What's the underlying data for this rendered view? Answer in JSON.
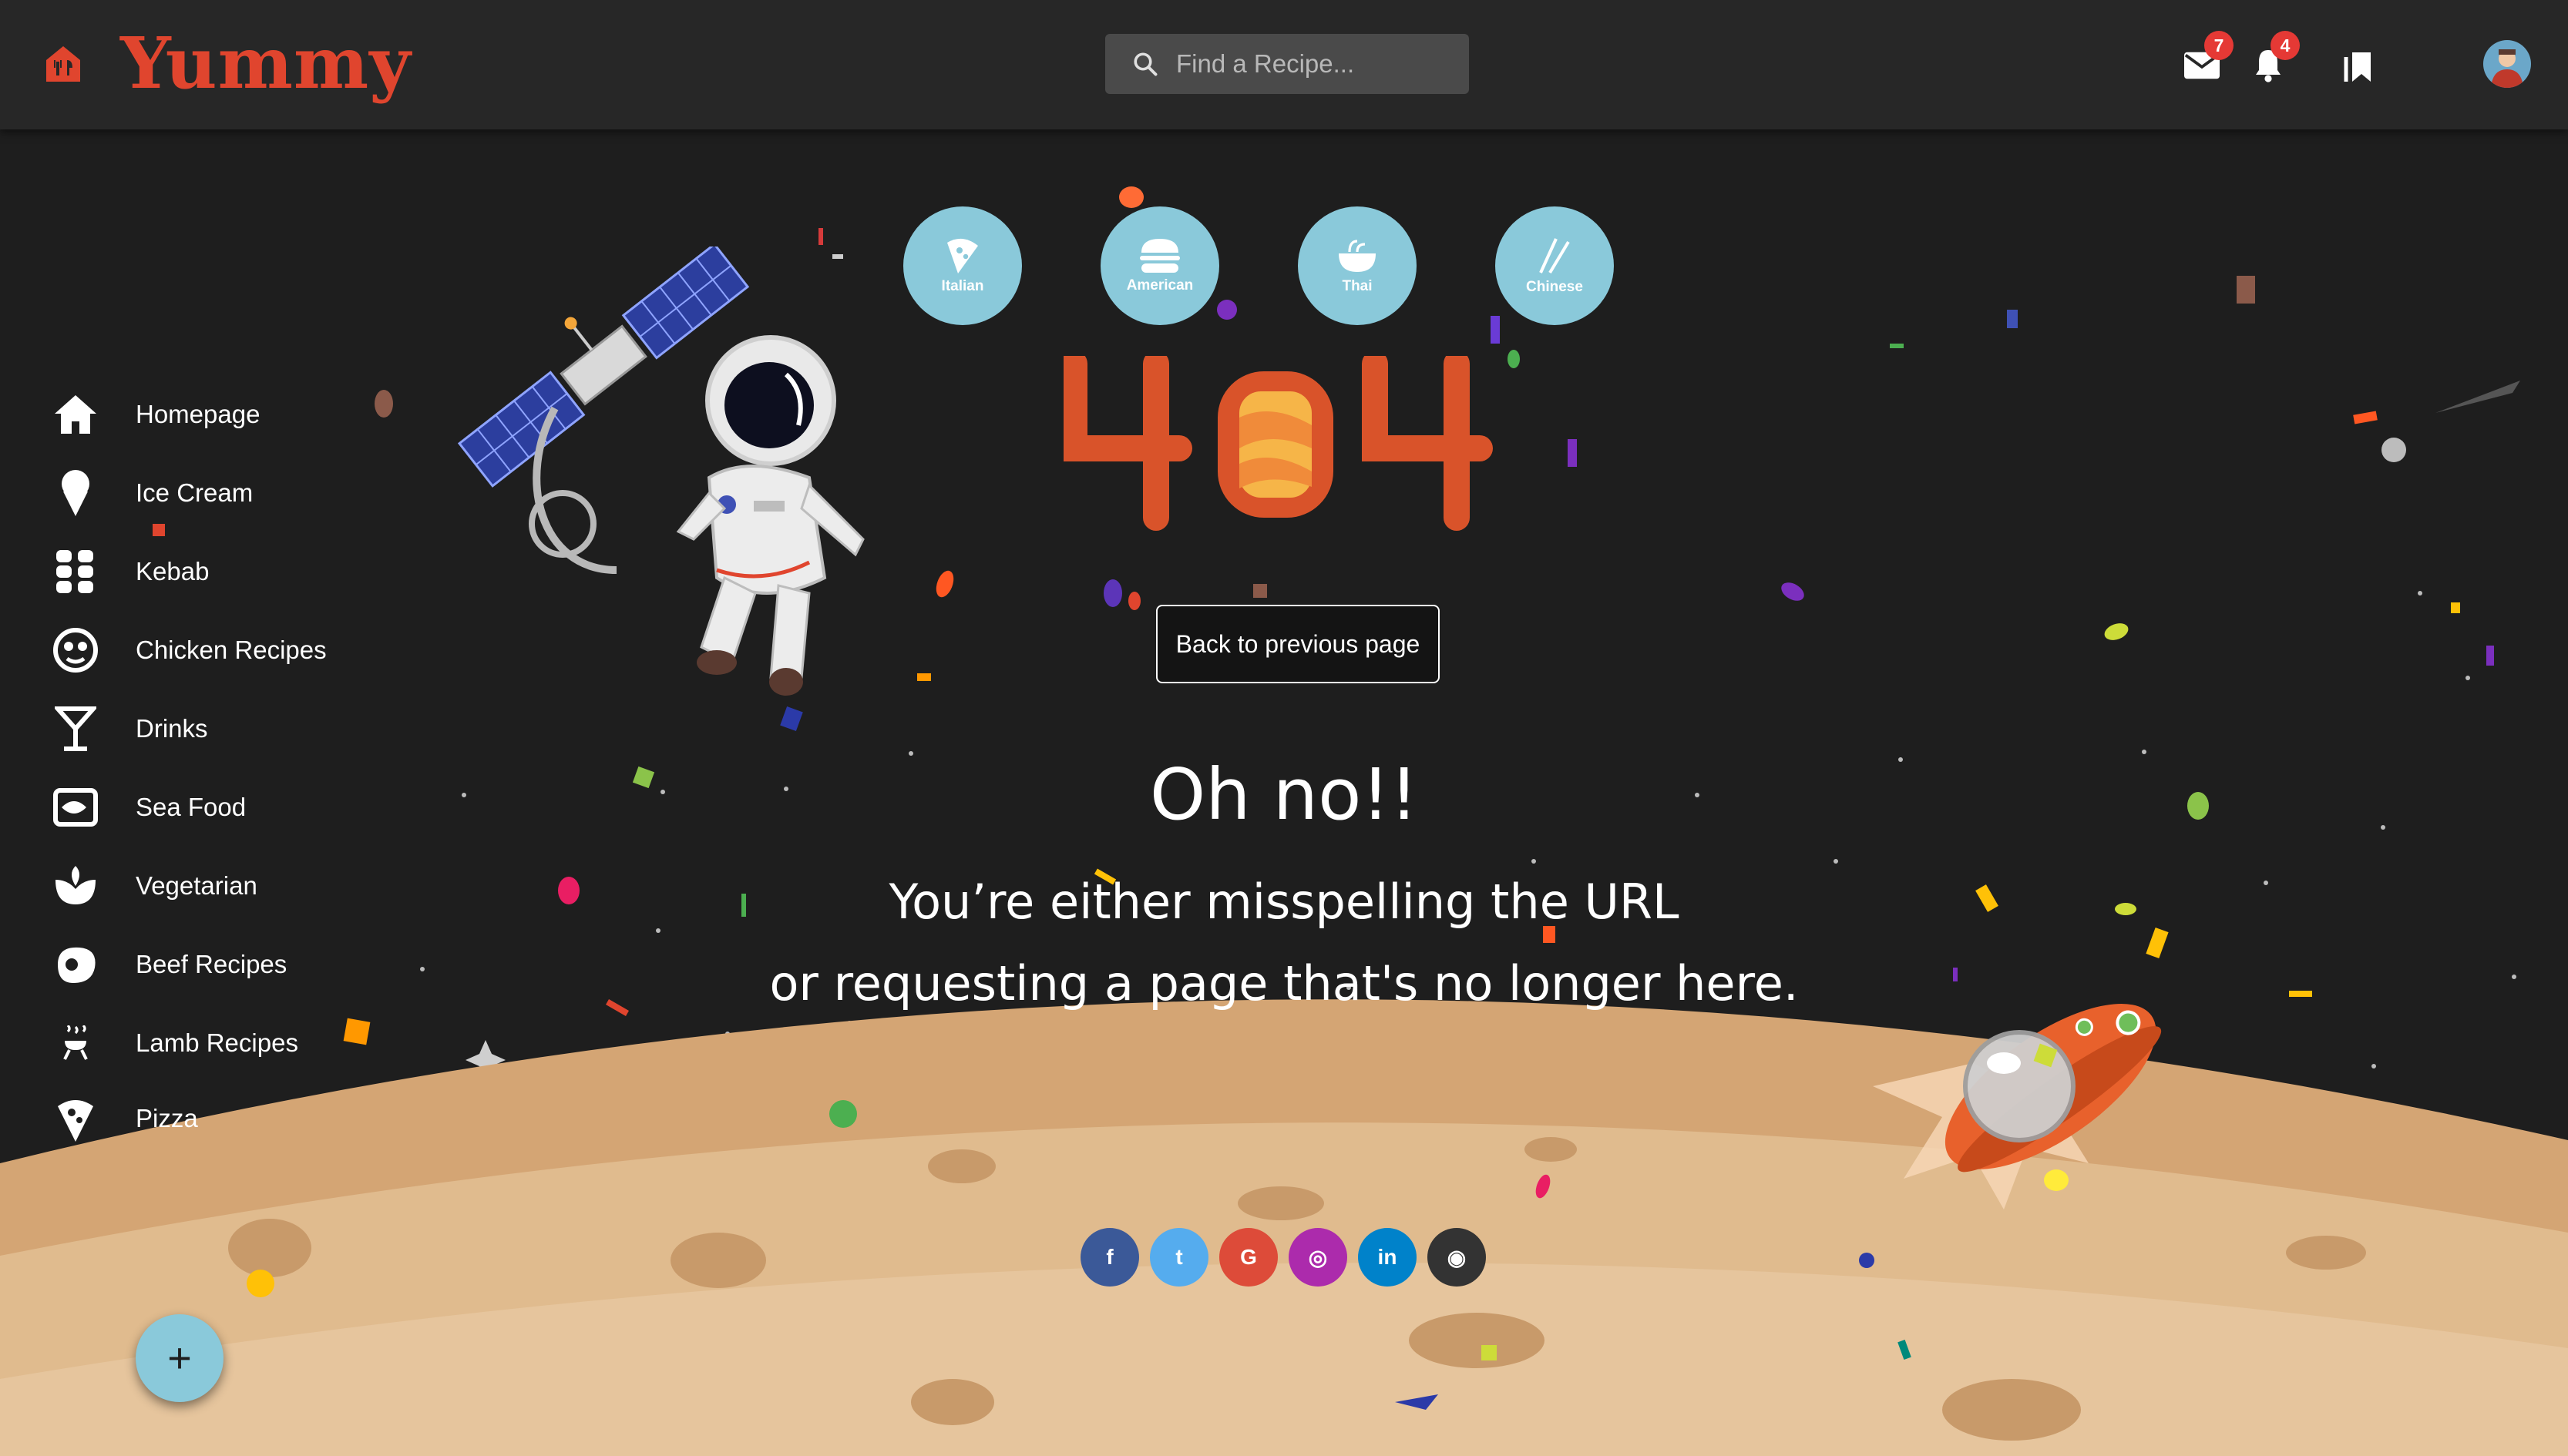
{
  "header": {
    "brand": "Yummy",
    "search_placeholder": "Find a Recipe...",
    "mail_count": "7",
    "notification_count": "4",
    "brand_color": "#e0452e"
  },
  "sidebar": {
    "items": [
      {
        "label": "Homepage",
        "icon": "home-icon"
      },
      {
        "label": "Ice Cream",
        "icon": "ice-cream-icon"
      },
      {
        "label": "Kebab",
        "icon": "kebab-icon"
      },
      {
        "label": "Chicken Recipes",
        "icon": "chicken-icon"
      },
      {
        "label": "Drinks",
        "icon": "cocktail-icon"
      },
      {
        "label": "Sea Food",
        "icon": "fish-icon"
      },
      {
        "label": "Vegetarian",
        "icon": "leaf-icon"
      },
      {
        "label": "Beef Recipes",
        "icon": "beef-icon"
      },
      {
        "label": "Lamb Recipes",
        "icon": "grill-icon"
      },
      {
        "label": "Pizza",
        "icon": "pizza-icon"
      }
    ]
  },
  "categories": [
    {
      "label": "Italian",
      "icon": "pizza-slice-icon"
    },
    {
      "label": "American",
      "icon": "burger-icon"
    },
    {
      "label": "Thai",
      "icon": "noodle-bowl-icon"
    },
    {
      "label": "Chinese",
      "icon": "chopsticks-icon"
    }
  ],
  "error": {
    "code": "404",
    "back_label": "Back to previous page",
    "title": "Oh no!!",
    "line1": "You’re either misspelling the URL",
    "line2": "or requesting a page that's no longer here."
  },
  "social": [
    {
      "name": "facebook",
      "glyph": "f",
      "color": "#3b5998"
    },
    {
      "name": "twitter",
      "glyph": "t",
      "color": "#55acee"
    },
    {
      "name": "google",
      "glyph": "G",
      "color": "#dd4b39"
    },
    {
      "name": "instagram",
      "glyph": "◎",
      "color": "#ac2bac"
    },
    {
      "name": "linkedin",
      "glyph": "in",
      "color": "#0082ca"
    },
    {
      "name": "github",
      "glyph": "◉",
      "color": "#333333"
    }
  ],
  "fab_label": "+"
}
